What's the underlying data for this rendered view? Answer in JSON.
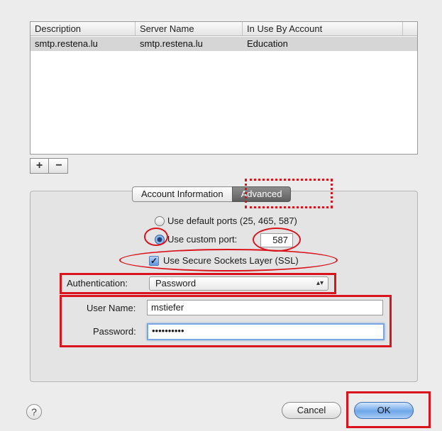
{
  "server_table": {
    "columns": [
      "Description",
      "Server Name",
      "In Use By Account"
    ],
    "rows": [
      [
        "smtp.restena.lu",
        "smtp.restena.lu",
        "Education"
      ]
    ]
  },
  "list_buttons": {
    "add": "+",
    "remove": "−"
  },
  "tabs": {
    "account_information": "Account Information",
    "advanced": "Advanced"
  },
  "ports": {
    "default_label": "Use default ports (25, 465, 587)",
    "custom_label": "Use custom port:",
    "custom_value": "587",
    "selected": "custom"
  },
  "ssl": {
    "label": "Use Secure Sockets Layer (SSL)",
    "checked": true
  },
  "auth": {
    "label": "Authentication:",
    "value": "Password"
  },
  "credentials": {
    "username_label": "User Name:",
    "username_value": "mstiefer",
    "password_label": "Password:",
    "password_value": "••••••••••"
  },
  "footer": {
    "help": "?",
    "cancel": "Cancel",
    "ok": "OK"
  },
  "colors": {
    "annotation_red": "#d9141c",
    "default_button_blue": "#6ea6e8"
  }
}
